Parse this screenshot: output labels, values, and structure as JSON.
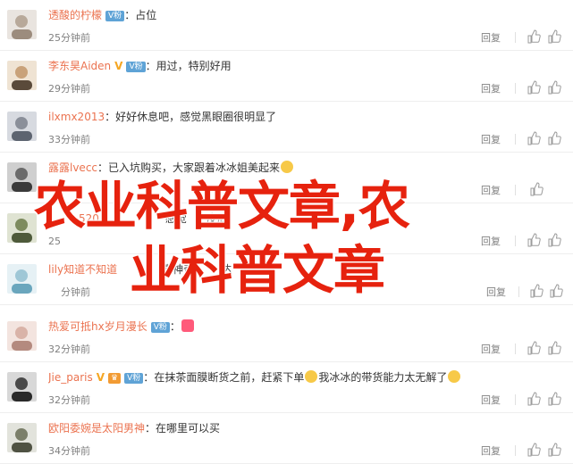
{
  "comments": [
    {
      "username": "透酸的柠檬",
      "badge_fan": "V粉",
      "vip": false,
      "verified": false,
      "text": "占位",
      "time": "25分钟前",
      "reply": "回复",
      "avatar_color": "#b8a99a"
    },
    {
      "username": "李东昊Aiden",
      "badge_fan": "V粉",
      "vip": false,
      "verified": true,
      "text": "用过，特别好用",
      "time": "29分钟前",
      "reply": "回复",
      "avatar_color": "#c9a27a"
    },
    {
      "username": "ilxmx2013",
      "badge_fan": "",
      "vip": false,
      "verified": false,
      "text": "好好休息吧，感觉黑眼圈很明显了",
      "time": "33分钟前",
      "reply": "回复",
      "avatar_color": "#8a8f99"
    },
    {
      "username": "露露lvecc",
      "badge_fan": "",
      "vip": false,
      "verified": false,
      "text": "已入坑购买，大家跟着冰冰姐美起来",
      "time": "",
      "reply": "回复",
      "avatar_color": "#6b6b6b",
      "emoji": "#f7c948"
    },
    {
      "username": "",
      "badge_fan": "",
      "vip": false,
      "verified": false,
      "text": "",
      "time": "",
      "reply": "回复",
      "avatar_color": "#7d8b5e"
    },
    {
      "username": "lily知道不知道",
      "badge_fan": "",
      "vip": false,
      "verified": false,
      "text": "",
      "time": "分钟前",
      "reply": "回复",
      "avatar_color": "#9fc7d6"
    },
    {
      "username": "热爱可抵hx岁月漫长",
      "badge_fan": "V粉",
      "vip": false,
      "verified": false,
      "text": "",
      "time": "32分钟前",
      "reply": "回复",
      "avatar_color": "#d9b3a8",
      "emoji": "#ff5a7a"
    },
    {
      "username": "Jie_paris",
      "badge_fan": "V粉",
      "vip": true,
      "verified": true,
      "text": "在抹茶面膜断货之前，赶紧下单",
      "text2": "我冰冰的带货能力太无解了",
      "time": "32分钟前",
      "reply": "回复",
      "avatar_color": "#4a4a4a",
      "emoji": "#f7c948"
    },
    {
      "username": "欧阳委婉是太阳男神",
      "badge_fan": "",
      "vip": false,
      "verified": false,
      "text": "在哪里可以买",
      "time": "34分钟前",
      "reply": "回复",
      "avatar_color": "#7b7f6a"
    }
  ],
  "partial_fragments": {
    "row4_name_tail": "520",
    "row4_time": "25",
    "row4_text_a": "感觉",
    "row4_text_b": "皮肤",
    "row5_text": "真神奇",
    "row5_text2": "达"
  },
  "overlay": {
    "line1": "农业科普文章,农",
    "line2": "业科普文章"
  },
  "colors": {
    "username": "#eb7350",
    "overlay": "#e6220e",
    "fan_badge": "#5fa3d6",
    "vip_badge": "#f29b33"
  }
}
